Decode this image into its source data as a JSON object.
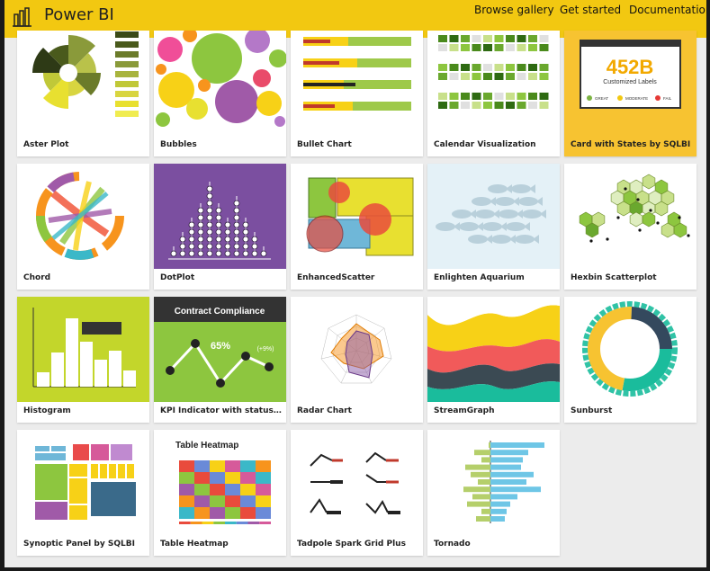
{
  "app": {
    "title": "Power BI"
  },
  "nav": {
    "browse": "Browse gallery",
    "started": "Get started",
    "docs": "Documentation"
  },
  "colors": {
    "header": "#f2c811",
    "background": "#ececec"
  },
  "icons": {
    "logo": "power-bi-logo-icon"
  },
  "cards": [
    {
      "label": "Aster Plot"
    },
    {
      "label": "Bubbles"
    },
    {
      "label": "Bullet Chart"
    },
    {
      "label": "Calendar Visualization"
    },
    {
      "label": "Card with States by SQLBI",
      "thumb_value": "452B",
      "thumb_caption": "Customized Labels",
      "thumb_legend": [
        "GREAT",
        "MODERATE",
        "FAIL"
      ]
    },
    {
      "label": "Chord"
    },
    {
      "label": "DotPlot"
    },
    {
      "label": "EnhancedScatter"
    },
    {
      "label": "Enlighten Aquarium"
    },
    {
      "label": "Hexbin Scatterplot"
    },
    {
      "label": "Histogram"
    },
    {
      "label": "KPI Indicator with status, de...",
      "thumb_title": "Contract Compliance",
      "thumb_value": "65%",
      "thumb_delta": "(+9%)"
    },
    {
      "label": "Radar Chart"
    },
    {
      "label": "StreamGraph"
    },
    {
      "label": "Sunburst"
    },
    {
      "label": "Synoptic Panel by SQLBI"
    },
    {
      "label": "Table Heatmap",
      "thumb_title": "Table Heatmap"
    },
    {
      "label": "Tadpole Spark Grid Plus"
    },
    {
      "label": "Tornado"
    }
  ]
}
